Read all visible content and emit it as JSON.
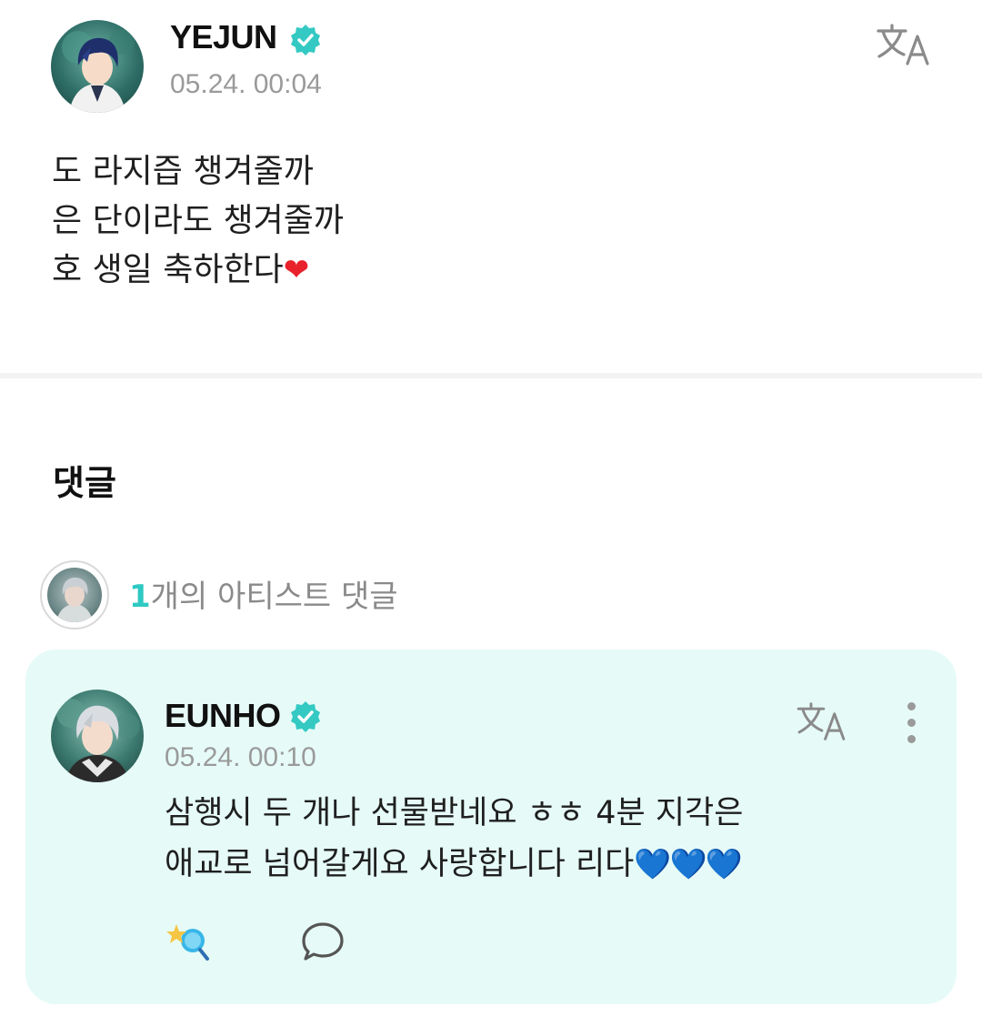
{
  "post": {
    "author": "YEJUN",
    "timestamp": "05.24. 00:04",
    "lines": [
      "도 라지즙 챙겨줄까",
      "은 단이라도 챙겨줄까",
      "호 생일 축하한다"
    ],
    "emoji_suffix": "❤",
    "translate_icon": "translate-icon",
    "verified_icon": "verified-badge-icon"
  },
  "comments": {
    "heading": "댓글",
    "artist_summary": {
      "count": "1",
      "label": "개의 아티스트 댓글"
    },
    "items": [
      {
        "author": "EUNHO",
        "timestamp": "05.24. 00:10",
        "lines": [
          "삼행시 두 개나 선물받네요 ㅎㅎ 4분 지각은",
          "애교로 넘어갈게요 사랑합니다 리다"
        ],
        "emoji_suffix": "💙💙💙",
        "icons": [
          "translate-icon",
          "more-options-icon",
          "star-like-icon",
          "reply-bubble-icon"
        ]
      }
    ]
  },
  "colors": {
    "accent": "#2ec9c2",
    "card_background": "#e6fbf7",
    "muted_text": "#9a9a9a",
    "heart_red": "#e8212b",
    "heart_blue": "#1e9ff2"
  }
}
